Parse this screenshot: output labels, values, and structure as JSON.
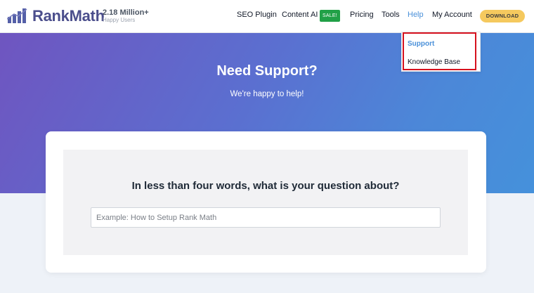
{
  "header": {
    "brand": "RankMath",
    "stats_number": "2.18 Million+",
    "stats_label": "Happy Users",
    "nav": {
      "seo_plugin": "SEO Plugin",
      "content_ai": "Content AI",
      "sale_badge": "SALE!",
      "pricing": "Pricing",
      "tools": "Tools",
      "help": "Help",
      "my_account": "My Account"
    },
    "download_label": "DOWNLOAD"
  },
  "help_dropdown": {
    "items": [
      "Support",
      "Knowledge Base"
    ]
  },
  "hero": {
    "title": "Need Support?",
    "subtitle": "We're happy to help!"
  },
  "search": {
    "question": "In less than four words, what is your question about?",
    "placeholder": "Example: How to Setup Rank Math",
    "value": ""
  },
  "colors": {
    "brand": "#4b4e8c",
    "link_blue": "#4a90d9",
    "sale_green": "#21a047",
    "download_yellow": "#f5c95e",
    "highlight_red": "#d6111e",
    "hero_gradient_start": "#6f55c0",
    "hero_gradient_end": "#4591db"
  },
  "icons": {
    "logo": "bar-chart-logo-icon"
  }
}
